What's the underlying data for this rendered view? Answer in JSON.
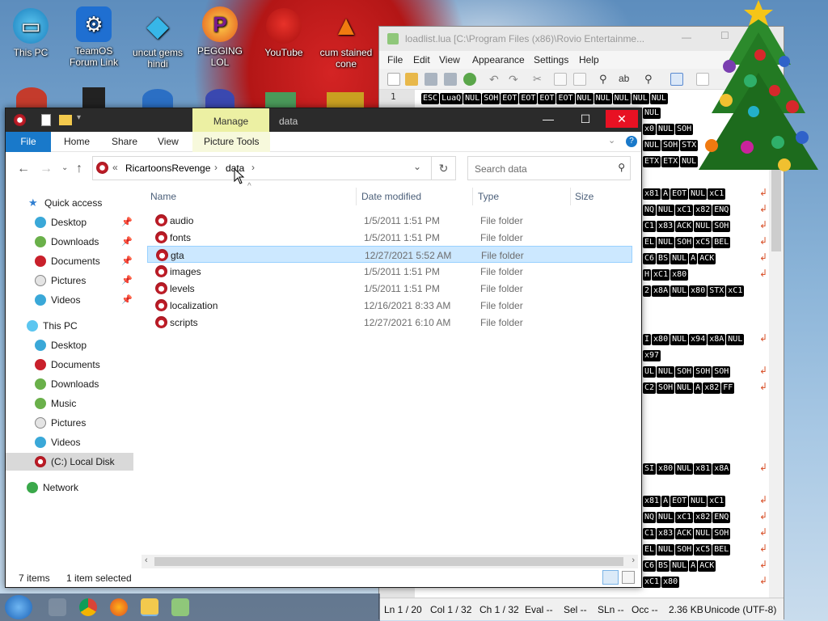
{
  "desktop": {
    "icons": [
      {
        "label": "This PC"
      },
      {
        "label": "TeamOS Forum Link"
      },
      {
        "label": "uncut gems hindi"
      },
      {
        "label": "PEGGING LOL"
      },
      {
        "label": "YouTube"
      },
      {
        "label": "cum stained cone"
      }
    ]
  },
  "explorer": {
    "title": "data",
    "manage_tab": "Manage",
    "ribbon_tabs": [
      "File",
      "Home",
      "Share",
      "View",
      "Picture Tools"
    ],
    "breadcrumb": {
      "overflow": "«",
      "parent": "RicartoonsRevenge",
      "current": "data"
    },
    "search_placeholder": "Search data",
    "columns": {
      "name": "Name",
      "date": "Date modified",
      "type": "Type",
      "size": "Size"
    },
    "files": [
      {
        "name": "audio",
        "date": "1/5/2011 1:51 PM",
        "type": "File folder"
      },
      {
        "name": "fonts",
        "date": "1/5/2011 1:51 PM",
        "type": "File folder"
      },
      {
        "name": "gta",
        "date": "12/27/2021 5:52 AM",
        "type": "File folder"
      },
      {
        "name": "images",
        "date": "1/5/2011 1:51 PM",
        "type": "File folder"
      },
      {
        "name": "levels",
        "date": "1/5/2011 1:51 PM",
        "type": "File folder"
      },
      {
        "name": "localization",
        "date": "12/16/2021 8:33 AM",
        "type": "File folder"
      },
      {
        "name": "scripts",
        "date": "12/27/2021 6:10 AM",
        "type": "File folder"
      }
    ],
    "nav": {
      "quick_access": "Quick access",
      "quick_items": [
        "Desktop",
        "Downloads",
        "Documents",
        "Pictures",
        "Videos"
      ],
      "this_pc": "This PC",
      "pc_items": [
        "Desktop",
        "Documents",
        "Downloads",
        "Music",
        "Pictures",
        "Videos",
        "(C:) Local Disk"
      ],
      "network": "Network"
    },
    "status": {
      "items": "7 items",
      "selected": "1 item selected"
    }
  },
  "notepad": {
    "title": "loadlist.lua [C:\\Program Files (x86)\\Rovio Entertainme...",
    "menu": [
      "File",
      "Edit",
      "View",
      "Appearance",
      "Settings",
      "Help"
    ],
    "line_number": "1",
    "line1_tokens": [
      "ESC",
      "LuaQ",
      "NUL",
      "SOH",
      "EOT",
      "EOT",
      "EOT",
      "EOT",
      "NUL",
      "NUL",
      "NUL",
      "NUL",
      "NUL"
    ],
    "status": {
      "ln": "Ln 1 / 20",
      "col": "Col 1 / 32",
      "ch": "Ch 1 / 32",
      "eval": "Eval --",
      "sel": "Sel --",
      "sln": "SLn --",
      "occ": "Occ --",
      "size": "2.36 KB",
      "encoding": "Unicode (UTF-8)"
    }
  },
  "colors": {
    "accent": "#1979ca",
    "selection": "#cce8ff",
    "manage": "#ecf0a3",
    "titlebar": "#2b2b2b"
  }
}
